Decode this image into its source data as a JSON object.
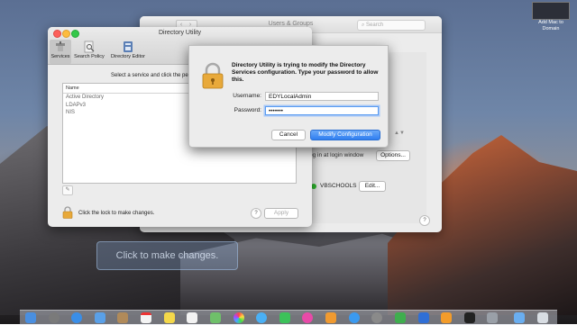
{
  "thumbnail": {
    "caption": "Add Mac to Domain"
  },
  "users_groups": {
    "title": "Users & Groups",
    "nav_back": "‹",
    "nav_forward": "›",
    "search_placeholder": "Search",
    "login_window_text": "og in at login window",
    "options_label": "Options...",
    "server_name": "VBSCHOOLS",
    "edit_label": "Edit...",
    "help_label": "?",
    "stepper_arrows": "▲▼"
  },
  "directory_utility": {
    "title": "Directory Utility",
    "toolbar": [
      {
        "label": "Services",
        "icon": "services-icon",
        "active": true
      },
      {
        "label": "Search Policy",
        "icon": "search-policy-icon",
        "active": false
      },
      {
        "label": "Directory Editor",
        "icon": "directory-editor-icon",
        "active": false
      }
    ],
    "prompt": "Select a service and click the pe",
    "table": {
      "column": "Name",
      "rows": [
        "Active Directory",
        "LDAPv3",
        "NIS"
      ]
    },
    "edit_icon_glyph": "✎",
    "lock_text": "Click the lock to make changes.",
    "help_label": "?",
    "apply_label": "Apply"
  },
  "auth_dialog": {
    "message": "Directory Utility is trying to modify the Directory Services configuration. Type your password to allow this.",
    "username_label": "Username:",
    "username_value": "EDYLocalAdmin",
    "password_label": "Password:",
    "password_value": "•••••••",
    "cancel_label": "Cancel",
    "modify_label": "Modify Configuration"
  },
  "overlay_bubble": {
    "text": "Click to make changes."
  },
  "colors": {
    "accent_blue": "#2f7ef0",
    "status_green": "#2eb82e",
    "lock_gold": "#e8a93a"
  },
  "dock_icons": [
    "finder-icon",
    "launchpad-icon",
    "safari-icon",
    "mail-icon",
    "contacts-icon",
    "calendar-icon",
    "notes-icon",
    "reminders-icon",
    "maps-icon",
    "photos-icon",
    "messages-icon",
    "facetime-icon",
    "itunes-icon",
    "ibooks-icon",
    "app-store-icon",
    "system-preferences-icon",
    "numbers-icon",
    "keynote-icon",
    "pages-icon",
    "terminal-icon",
    "utility-icon",
    "folder-icon",
    "trash-icon"
  ]
}
